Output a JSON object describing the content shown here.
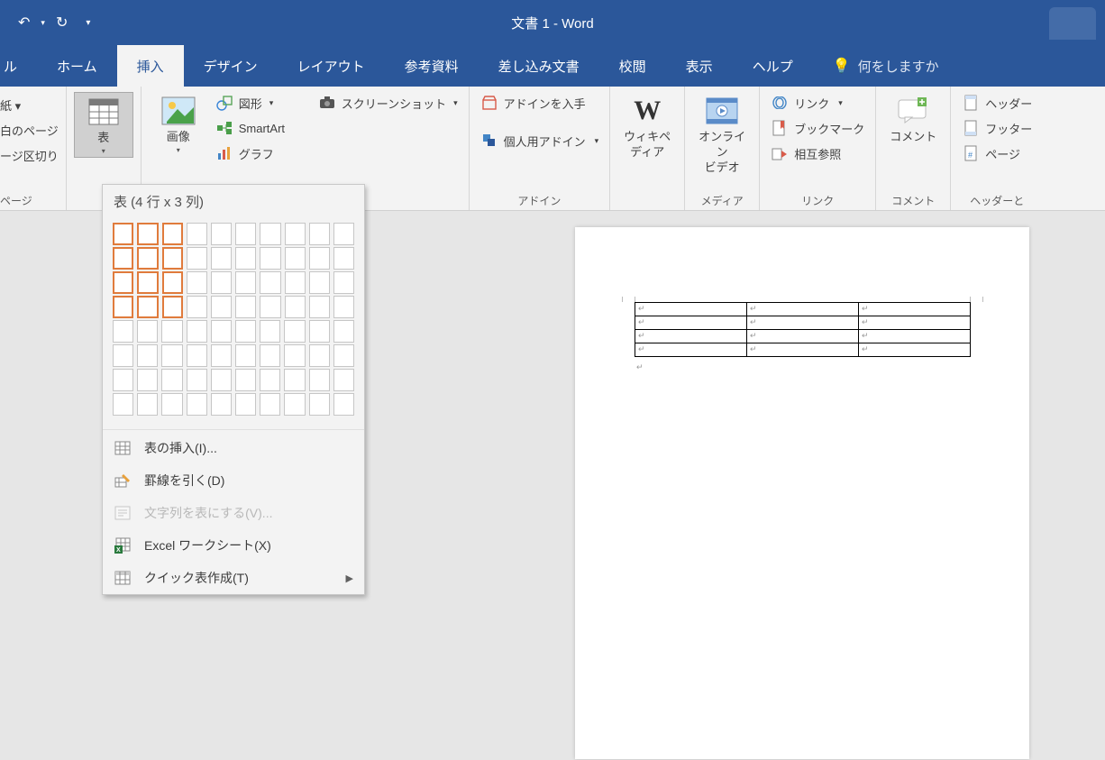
{
  "title": "文書 1  -  Word",
  "qat": {
    "undo": "↶",
    "redo": "↻"
  },
  "tabs": {
    "file_partial": "ル",
    "home": "ホーム",
    "insert": "挿入",
    "design": "デザイン",
    "layout": "レイアウト",
    "references": "参考資料",
    "mailings": "差し込み文書",
    "review": "校閲",
    "view": "表示",
    "help": "ヘルプ",
    "tellme": "何をしますか"
  },
  "ribbon": {
    "pages": {
      "cover_partial": "紙 ▾",
      "blank_partial": "白のページ",
      "break_partial": "ージ区切り",
      "label": "ページ"
    },
    "table": {
      "label": "表"
    },
    "images": {
      "pictures": "画像",
      "shapes": "図形",
      "smartart": "SmartArt",
      "chart": "グラフ",
      "screenshot": "スクリーンショット"
    },
    "addins": {
      "get": "アドインを入手",
      "my": "個人用アドイン",
      "label": "アドイン"
    },
    "wiki": {
      "l1": "ウィキペ",
      "l2": "ディア"
    },
    "media": {
      "l1": "オンライン",
      "l2": "ビデオ",
      "label": "メディア"
    },
    "links": {
      "link": "リンク",
      "bookmark": "ブックマーク",
      "crossref": "相互参照",
      "label": "リンク"
    },
    "comment": {
      "label": "コメント",
      "group": "コメント"
    },
    "hf": {
      "header": "ヘッダー",
      "footer": "フッター",
      "page": "ページ",
      "label_partial": "ヘッダーと"
    }
  },
  "dropdown": {
    "header": "表 (4 行 x 3 列)",
    "selected_rows": 4,
    "selected_cols": 3,
    "insert": "表の挿入(I)...",
    "draw": "罫線を引く(D)",
    "convert": "文字列を表にする(V)...",
    "excel": "Excel ワークシート(X)",
    "quick": "クイック表作成(T)"
  },
  "doc": {
    "para": "↵"
  }
}
